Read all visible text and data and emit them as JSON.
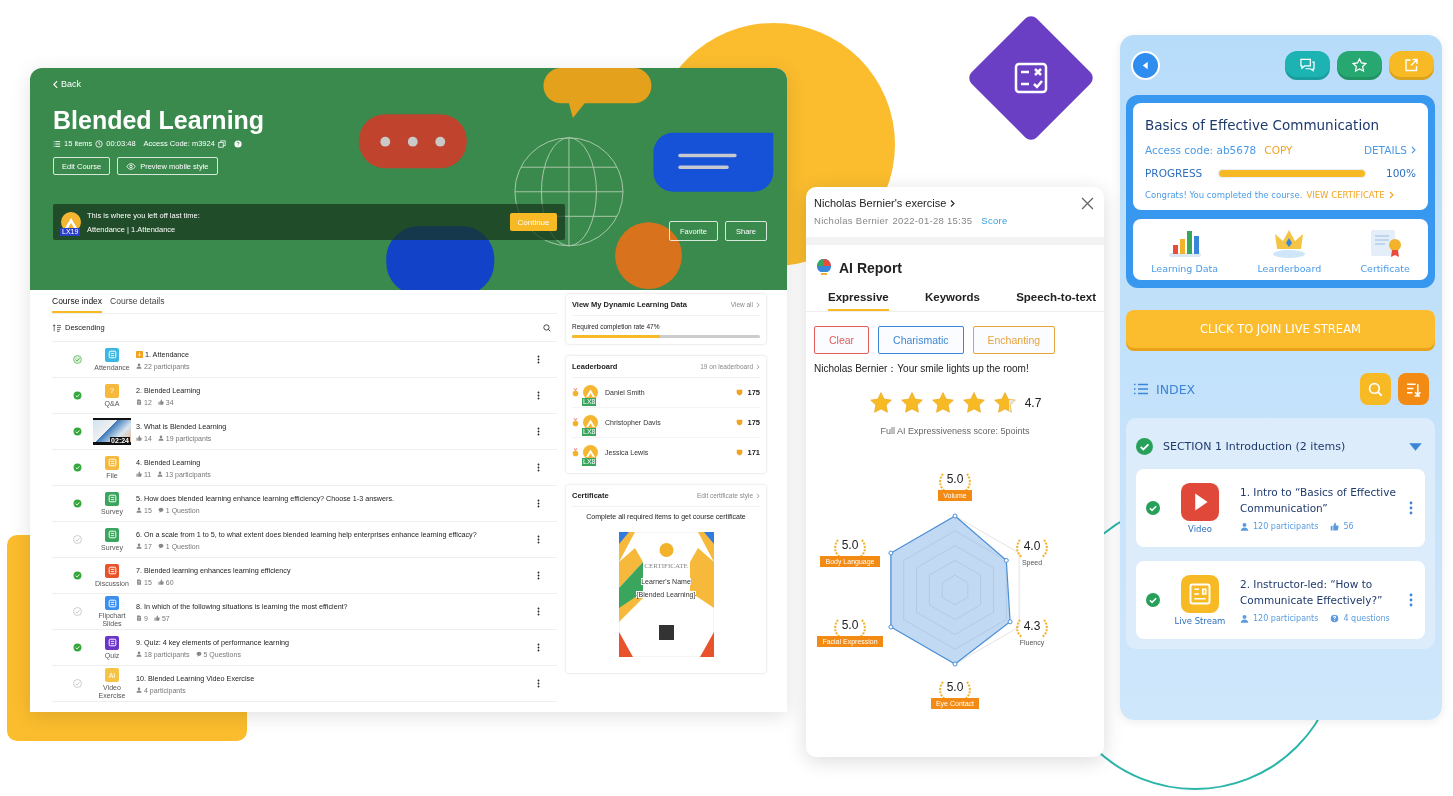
{
  "course_page": {
    "back": "Back",
    "title": "Blended Learning",
    "meta": {
      "items": "15 items",
      "duration": "00:03:48",
      "access_code": "Access Code: m3924"
    },
    "buttons": [
      {
        "kind": "edit",
        "label": "Edit Course"
      },
      {
        "kind": "preview",
        "label": "Preview mobile style"
      }
    ],
    "resume": {
      "badge": "LX19",
      "prompt": "This is where you left off last time:",
      "location": "Attendance | 1.Attendance",
      "button": "Continue"
    },
    "actions": [
      "Favorite",
      "Share"
    ],
    "tabs": [
      {
        "label": "Course index",
        "selected": true
      },
      {
        "label": "Course details",
        "selected": false
      }
    ],
    "sort": "Descending",
    "items": [
      {
        "kind": "attendance",
        "type_label": "Attendance",
        "color": "#3bb7e3",
        "completed": false,
        "in_progress": true,
        "pinned": true,
        "title": "1. Attendance",
        "stats": [
          {
            "kind": "person",
            "text": "22 participants"
          }
        ]
      },
      {
        "kind": "qa",
        "type_label": "Q&A",
        "icon_text": "?",
        "color": "#f6b93b",
        "completed": true,
        "in_progress": false,
        "pinned": false,
        "title": "2. Blended Learning",
        "stats": [
          {
            "kind": "doc",
            "text": "12"
          },
          {
            "kind": "thumb",
            "text": "34"
          }
        ]
      },
      {
        "kind": "video",
        "duration": "02:24",
        "completed": true,
        "in_progress": false,
        "pinned": false,
        "title": "3. What is Blended Learning",
        "stats": [
          {
            "kind": "thumb",
            "text": "14"
          },
          {
            "kind": "person",
            "text": "19 participants"
          }
        ]
      },
      {
        "kind": "file",
        "type_label": "File",
        "color": "#f6b93b",
        "completed": true,
        "in_progress": false,
        "pinned": false,
        "title": "4. Blended Learning",
        "stats": [
          {
            "kind": "thumb",
            "text": "11"
          },
          {
            "kind": "person",
            "text": "13 participants"
          }
        ]
      },
      {
        "kind": "survey",
        "type_label": "Survey",
        "color": "#3aa55d",
        "completed": true,
        "in_progress": false,
        "pinned": false,
        "title": "5. How does blended learning enhance learning efficiency? Choose 1-3 answers.",
        "stats": [
          {
            "kind": "person",
            "text": "15"
          },
          {
            "kind": "bubble",
            "text": "1 Question"
          }
        ]
      },
      {
        "kind": "survey",
        "type_label": "Survey",
        "color": "#3aa55d",
        "completed": false,
        "in_progress": false,
        "pinned": false,
        "title": "6. On a scale from 1 to 5, to what extent does blended learning help enterprises enhance learning efficacy?",
        "stats": [
          {
            "kind": "person",
            "text": "17"
          },
          {
            "kind": "bubble",
            "text": "1 Question"
          }
        ]
      },
      {
        "kind": "discussion",
        "type_label": "Discussion",
        "color": "#e9532b",
        "completed": true,
        "in_progress": false,
        "pinned": false,
        "title": "7. Blended learning enhances learning efficiency",
        "stats": [
          {
            "kind": "doc",
            "text": "15"
          },
          {
            "kind": "thumb",
            "text": "60"
          }
        ]
      },
      {
        "kind": "flipchart",
        "type_label": "Flipchart Slides",
        "color": "#3b8ff0",
        "completed": false,
        "in_progress": false,
        "pinned": false,
        "title": "8. In which of the following situations is learning the most efficient?",
        "stats": [
          {
            "kind": "doc",
            "text": "9"
          },
          {
            "kind": "thumb",
            "text": "57"
          }
        ]
      },
      {
        "kind": "quiz",
        "type_label": "Quiz",
        "color": "#6a35c8",
        "completed": true,
        "in_progress": false,
        "pinned": false,
        "title": "9. Quiz: 4 key elements of performance learning",
        "stats": [
          {
            "kind": "person",
            "text": "18 participants"
          },
          {
            "kind": "bubble",
            "text": "5 Questions"
          }
        ]
      },
      {
        "kind": "ai",
        "type_label": "Video Exercise",
        "icon_text": "AI",
        "color": "#f6c445",
        "completed": false,
        "in_progress": false,
        "pinned": false,
        "title": "10. Blended Learning Video Exercise",
        "stats": [
          {
            "kind": "person",
            "text": "4 participants"
          }
        ]
      }
    ]
  },
  "side": {
    "learning_data": {
      "title": "View My Dynamic Learning Data",
      "link": "View all",
      "rate": "Required completion rate 47%",
      "level": 0.47
    },
    "leaderboard": {
      "title": "Leaderboard",
      "count": "19 on leaderboard",
      "rows": [
        {
          "name": "Daniel Smith",
          "badge": "LX8",
          "score": "175"
        },
        {
          "name": "Christopher Davis",
          "badge": "LX8",
          "score": "175"
        },
        {
          "name": "Jessica Lewis",
          "badge": "LX8",
          "score": "171"
        }
      ]
    },
    "certificate": {
      "title": "Certificate",
      "link": "Edit certificate style",
      "description": "Complete all required items to get course certificate",
      "heading": "CERTIFICATE",
      "learner": "Learner's Name",
      "course": "{Blended Learning}"
    }
  },
  "exercise": {
    "title": "Nicholas Bernier's exercise",
    "learner": "Nicholas Bernier",
    "date": "2022-01-28 15:35",
    "score_link": "Score"
  },
  "ai_report": {
    "title": "AI Report",
    "tabs": [
      {
        "label": "Expressive",
        "selected": true
      },
      {
        "label": "Keywords",
        "selected": false
      },
      {
        "label": "Speech-to-text",
        "selected": false
      }
    ],
    "tags": [
      {
        "label": "Clear",
        "color": "#e25b5b"
      },
      {
        "label": "Charismatic",
        "color": "#3b87d6"
      },
      {
        "label": "Enchanting",
        "color": "#e6a23c"
      }
    ],
    "comment": "Nicholas Bernier：Your smile lights up the room!",
    "stars": 4.7,
    "rating": "4.7",
    "full_score": "Full AI Expressiveness score: 5points",
    "metrics": [
      {
        "label": "Volume",
        "score": "5.0",
        "ribbon": true
      },
      {
        "label": "Body Language",
        "score": "5.0",
        "ribbon": true
      },
      {
        "label": "Speed",
        "score": "4.0",
        "ribbon": false
      },
      {
        "label": "Facial Expression",
        "score": "5.0",
        "ribbon": true
      },
      {
        "label": "Fluency",
        "score": "4.3",
        "ribbon": false
      },
      {
        "label": "Eye Contact",
        "score": "5.0",
        "ribbon": true
      }
    ]
  },
  "mobile": {
    "course": {
      "title": "Basics of Effective Communication",
      "access_code": "Access code: ab5678",
      "copy": "COPY",
      "details": "DETAILS",
      "progress_label": "PROGRESS",
      "level": 1,
      "progress": "100%",
      "congrats": "Congrats! You completed the course.",
      "certificate_link": "VIEW CERTIFICATE"
    },
    "shortcuts": [
      {
        "kind": "chart",
        "label": "Learning Data"
      },
      {
        "kind": "crown",
        "label": "Learderboard"
      },
      {
        "kind": "certificate",
        "label": "Certificate"
      }
    ],
    "live_button": "CLICK TO JOIN LIVE STREAM",
    "index_label": "INDEX",
    "section": {
      "title": "SECTION 1 Introduction (2 items)",
      "done": true,
      "expanded": true,
      "items": [
        {
          "kind": "video",
          "type_label": "Video",
          "done": true,
          "title": "1. Intro to “Basics of Effective Communication”",
          "stats": [
            {
              "kind": "person",
              "text": "120 participants"
            },
            {
              "kind": "thumb",
              "text": "56"
            }
          ]
        },
        {
          "kind": "live",
          "type_label": "Live Stream",
          "done": true,
          "title": "2. Instructor-led: “How to Communicate Effectively?”",
          "stats": [
            {
              "kind": "person",
              "text": "120 participants"
            },
            {
              "kind": "question",
              "text": "4 questions"
            }
          ]
        }
      ]
    }
  }
}
